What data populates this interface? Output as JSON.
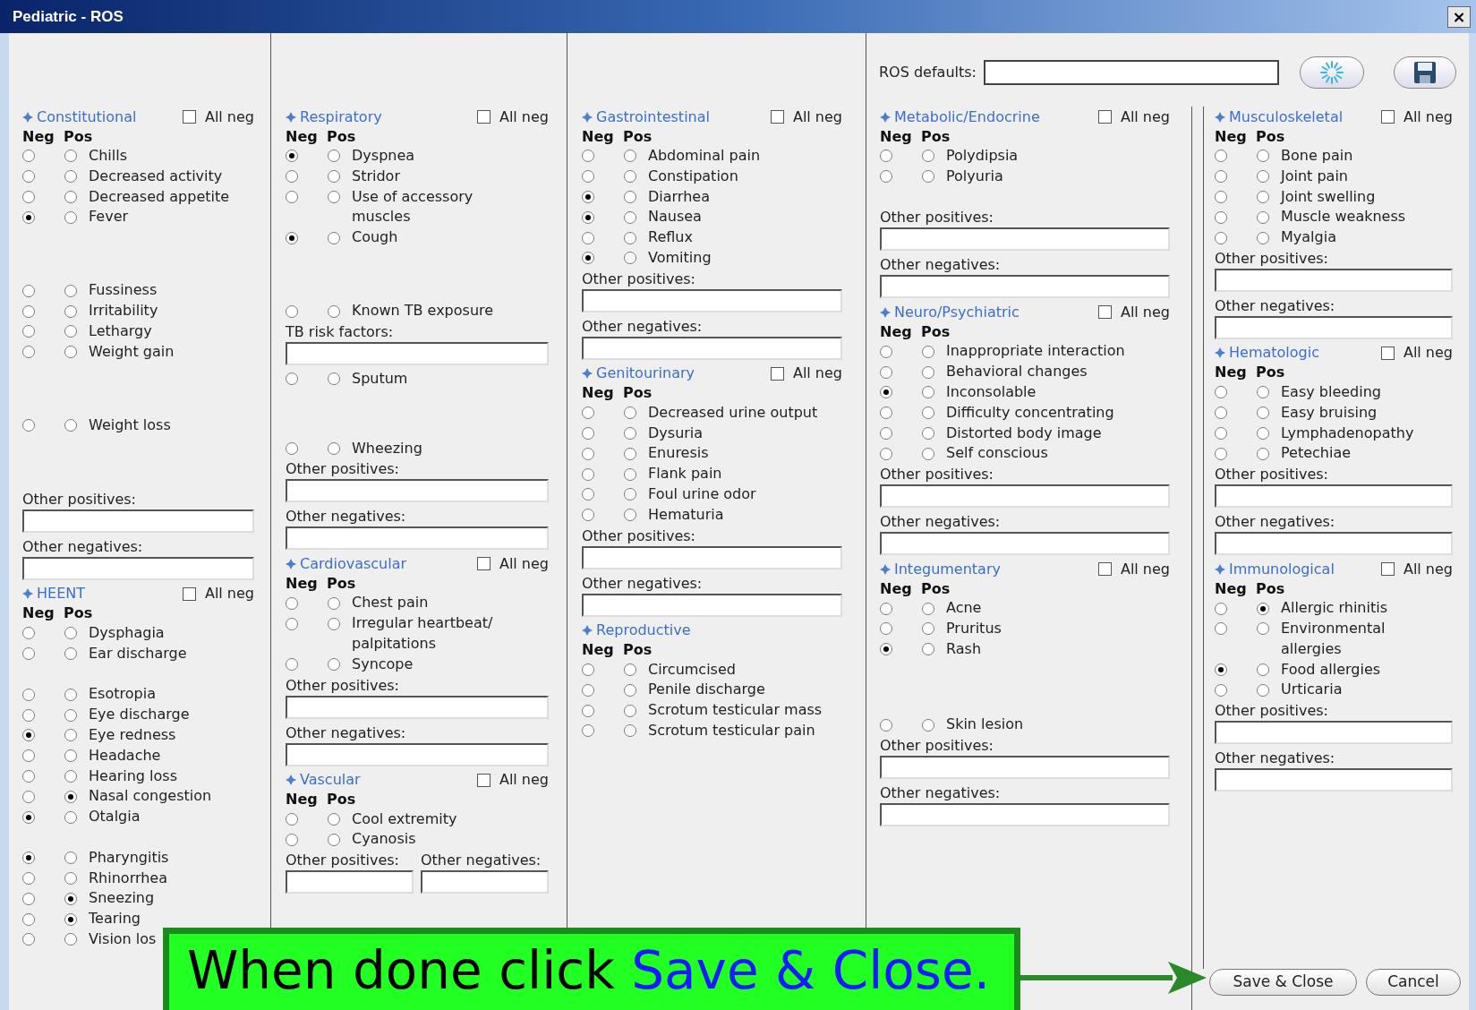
{
  "window": {
    "title": "Pediatric - ROS",
    "close": "×"
  },
  "ros_defaults": {
    "label": "ROS defaults:"
  },
  "columns": [
    {
      "sections": [
        {
          "title": "Constitutional",
          "all_neg": {
            "label": "All neg",
            "checked": false
          },
          "neg_label": "Neg",
          "pos_label": "Pos",
          "items": [
            {
              "kind": "radio",
              "label": "Chills",
              "neg_selected": false,
              "pos_selected": false
            },
            {
              "kind": "radio",
              "label": "Decreased activity",
              "neg_selected": false,
              "pos_selected": false
            },
            {
              "kind": "radio",
              "label": "Decreased appetite",
              "neg_selected": false,
              "pos_selected": false
            },
            {
              "kind": "radio",
              "label": "Fever",
              "neg_selected": true,
              "pos_selected": false
            },
            {
              "kind": "radio",
              "label": "Fussiness",
              "neg_selected": false,
              "pos_selected": false
            },
            {
              "kind": "radio",
              "label": "Irritability",
              "neg_selected": false,
              "pos_selected": false
            },
            {
              "kind": "radio",
              "label": "Lethargy",
              "neg_selected": false,
              "pos_selected": false
            },
            {
              "kind": "radio",
              "label": "Weight gain",
              "neg_selected": false,
              "pos_selected": false
            },
            {
              "kind": "radio",
              "label": "Weight loss",
              "neg_selected": false,
              "pos_selected": false
            }
          ],
          "fields": [
            {
              "label": "Other positives:"
            },
            {
              "label": "Other negatives:"
            }
          ]
        },
        {
          "title": "HEENT",
          "all_neg": {
            "label": "All neg",
            "checked": false
          },
          "neg_label": "Neg",
          "pos_label": "Pos",
          "items": [
            {
              "kind": "radio",
              "label": "Dysphagia",
              "neg_selected": false,
              "pos_selected": false
            },
            {
              "kind": "radio",
              "label": "Ear discharge",
              "neg_selected": false,
              "pos_selected": false
            },
            {
              "kind": "radio",
              "label": "Esotropia",
              "neg_selected": false,
              "pos_selected": false
            },
            {
              "kind": "radio",
              "label": "Eye discharge",
              "neg_selected": false,
              "pos_selected": false
            },
            {
              "kind": "radio",
              "label": "Eye redness",
              "neg_selected": true,
              "pos_selected": false
            },
            {
              "kind": "radio",
              "label": "Headache",
              "neg_selected": false,
              "pos_selected": false
            },
            {
              "kind": "radio",
              "label": "Hearing loss",
              "neg_selected": false,
              "pos_selected": false
            },
            {
              "kind": "radio",
              "label": "Nasal congestion",
              "neg_selected": false,
              "pos_selected": true
            },
            {
              "kind": "radio",
              "label": "Otalgia",
              "neg_selected": true,
              "pos_selected": false
            },
            {
              "kind": "radio",
              "label": "Pharyngitis",
              "neg_selected": true,
              "pos_selected": false
            },
            {
              "kind": "radio",
              "label": "Rhinorrhea",
              "neg_selected": false,
              "pos_selected": false
            },
            {
              "kind": "radio",
              "label": "Sneezing",
              "neg_selected": false,
              "pos_selected": true
            },
            {
              "kind": "radio",
              "label": "Tearing",
              "neg_selected": false,
              "pos_selected": true
            },
            {
              "kind": "radio",
              "label": "Vision los",
              "neg_selected": false,
              "pos_selected": false
            }
          ]
        }
      ]
    },
    {
      "sections": [
        {
          "title": "Respiratory",
          "all_neg": {
            "label": "All neg",
            "checked": false
          },
          "neg_label": "Neg",
          "pos_label": "Pos",
          "items": [
            {
              "kind": "radio",
              "label": "Dyspnea",
              "neg_selected": true,
              "pos_selected": false
            },
            {
              "kind": "radio",
              "label": "Stridor",
              "neg_selected": false,
              "pos_selected": false
            },
            {
              "kind": "radio",
              "label": "Use of accessory\nmuscles",
              "neg_selected": false,
              "pos_selected": false
            },
            {
              "kind": "radio",
              "label": "Cough",
              "neg_selected": true,
              "pos_selected": false
            },
            {
              "kind": "radio",
              "label": "Known TB exposure",
              "neg_selected": false,
              "pos_selected": false
            },
            {
              "kind": "field",
              "label": "TB risk factors:"
            },
            {
              "kind": "radio",
              "label": "Sputum",
              "neg_selected": false,
              "pos_selected": false
            },
            {
              "kind": "radio",
              "label": "Wheezing",
              "neg_selected": false,
              "pos_selected": false
            }
          ],
          "fields": [
            {
              "label": "Other positives:"
            },
            {
              "label": "Other negatives:"
            }
          ]
        },
        {
          "title": "Cardiovascular",
          "all_neg": {
            "label": "All neg",
            "checked": false
          },
          "neg_label": "Neg",
          "pos_label": "Pos",
          "items": [
            {
              "kind": "radio",
              "label": "Chest pain",
              "neg_selected": false,
              "pos_selected": false
            },
            {
              "kind": "radio",
              "label": "Irregular heartbeat/\npalpitations",
              "neg_selected": false,
              "pos_selected": false
            },
            {
              "kind": "radio",
              "label": "Syncope",
              "neg_selected": false,
              "pos_selected": false
            }
          ],
          "fields": [
            {
              "label": "Other positives:"
            },
            {
              "label": "Other negatives:"
            }
          ]
        },
        {
          "title": "Vascular",
          "all_neg": {
            "label": "All neg",
            "checked": false
          },
          "neg_label": "Neg",
          "pos_label": "Pos",
          "items": [
            {
              "kind": "radio",
              "label": "Cool extremity",
              "neg_selected": false,
              "pos_selected": false
            },
            {
              "kind": "radio",
              "label": "Cyanosis",
              "neg_selected": false,
              "pos_selected": false
            }
          ],
          "fields_inline": true,
          "fields": [
            {
              "label": "Other positives:"
            },
            {
              "label": "Other negatives:"
            }
          ]
        }
      ]
    },
    {
      "sections": [
        {
          "title": "Gastrointestinal",
          "all_neg": {
            "label": "All neg",
            "checked": false
          },
          "neg_label": "Neg",
          "pos_label": "Pos",
          "items": [
            {
              "kind": "radio",
              "label": "Abdominal pain",
              "neg_selected": false,
              "pos_selected": false
            },
            {
              "kind": "radio",
              "label": "Constipation",
              "neg_selected": false,
              "pos_selected": false
            },
            {
              "kind": "radio",
              "label": "Diarrhea",
              "neg_selected": true,
              "pos_selected": false
            },
            {
              "kind": "radio",
              "label": "Nausea",
              "neg_selected": true,
              "pos_selected": false
            },
            {
              "kind": "radio",
              "label": "Reflux",
              "neg_selected": false,
              "pos_selected": false
            },
            {
              "kind": "radio",
              "label": "Vomiting",
              "neg_selected": true,
              "pos_selected": false
            }
          ],
          "fields": [
            {
              "label": "Other positives:"
            },
            {
              "label": "Other negatives:"
            }
          ]
        },
        {
          "title": "Genitourinary",
          "all_neg": {
            "label": "All neg",
            "checked": false
          },
          "neg_label": "Neg",
          "pos_label": "Pos",
          "items": [
            {
              "kind": "radio",
              "label": "Decreased urine output",
              "neg_selected": false,
              "pos_selected": false
            },
            {
              "kind": "radio",
              "label": "Dysuria",
              "neg_selected": false,
              "pos_selected": false
            },
            {
              "kind": "radio",
              "label": "Enuresis",
              "neg_selected": false,
              "pos_selected": false
            },
            {
              "kind": "radio",
              "label": "Flank pain",
              "neg_selected": false,
              "pos_selected": false
            },
            {
              "kind": "radio",
              "label": "Foul urine odor",
              "neg_selected": false,
              "pos_selected": false
            },
            {
              "kind": "radio",
              "label": "Hematuria",
              "neg_selected": false,
              "pos_selected": false
            }
          ],
          "fields": [
            {
              "label": "Other positives:"
            },
            {
              "label": "Other negatives:"
            }
          ]
        },
        {
          "title": "Reproductive",
          "neg_label": "Neg",
          "pos_label": "Pos",
          "items": [
            {
              "kind": "radio",
              "label": "Circumcised",
              "neg_selected": false,
              "pos_selected": false
            },
            {
              "kind": "radio",
              "label": "Penile discharge",
              "neg_selected": false,
              "pos_selected": false
            },
            {
              "kind": "radio",
              "label": "Scrotum testicular mass",
              "neg_selected": false,
              "pos_selected": false
            },
            {
              "kind": "radio",
              "label": "Scrotum testicular pain",
              "neg_selected": false,
              "pos_selected": false
            }
          ]
        }
      ]
    },
    {
      "sections": [
        {
          "title": "Metabolic/Endocrine",
          "all_neg": {
            "label": "All neg",
            "checked": false
          },
          "neg_label": "Neg",
          "pos_label": "Pos",
          "items": [
            {
              "kind": "radio",
              "label": "Polydipsia",
              "neg_selected": false,
              "pos_selected": false
            },
            {
              "kind": "radio",
              "label": "Polyuria",
              "neg_selected": false,
              "pos_selected": false
            }
          ],
          "fields": [
            {
              "label": "Other positives:"
            },
            {
              "label": "Other negatives:"
            }
          ]
        },
        {
          "title": "Neuro/Psychiatric",
          "all_neg": {
            "label": "All neg",
            "checked": false
          },
          "neg_label": "Neg",
          "pos_label": "Pos",
          "items": [
            {
              "kind": "radio",
              "label": "Inappropriate interaction",
              "neg_selected": false,
              "pos_selected": false
            },
            {
              "kind": "radio",
              "label": "Behavioral changes",
              "neg_selected": false,
              "pos_selected": false
            },
            {
              "kind": "radio",
              "label": "Inconsolable",
              "neg_selected": true,
              "pos_selected": false
            },
            {
              "kind": "radio",
              "label": "Difficulty concentrating",
              "neg_selected": false,
              "pos_selected": false
            },
            {
              "kind": "radio",
              "label": "Distorted body image",
              "neg_selected": false,
              "pos_selected": false
            },
            {
              "kind": "radio",
              "label": "Self conscious",
              "neg_selected": false,
              "pos_selected": false
            }
          ],
          "fields": [
            {
              "label": "Other positives:"
            },
            {
              "label": "Other negatives:"
            }
          ]
        },
        {
          "title": "Integumentary",
          "all_neg": {
            "label": "All neg",
            "checked": false
          },
          "neg_label": "Neg",
          "pos_label": "Pos",
          "items": [
            {
              "kind": "radio",
              "label": "Acne",
              "neg_selected": false,
              "pos_selected": false
            },
            {
              "kind": "radio",
              "label": "Pruritus",
              "neg_selected": false,
              "pos_selected": false
            },
            {
              "kind": "radio",
              "label": "Rash",
              "neg_selected": true,
              "pos_selected": false
            },
            {
              "kind": "radio",
              "label": "Skin lesion",
              "neg_selected": false,
              "pos_selected": false
            }
          ],
          "fields": [
            {
              "label": "Other positives:"
            },
            {
              "label": "Other negatives:"
            }
          ]
        }
      ]
    },
    {
      "sections": [
        {
          "title": "Musculoskeletal",
          "all_neg": {
            "label": "All neg",
            "checked": false
          },
          "neg_label": "Neg",
          "pos_label": "Pos",
          "items": [
            {
              "kind": "radio",
              "label": "Bone pain",
              "neg_selected": false,
              "pos_selected": false
            },
            {
              "kind": "radio",
              "label": "Joint pain",
              "neg_selected": false,
              "pos_selected": false
            },
            {
              "kind": "radio",
              "label": "Joint swelling",
              "neg_selected": false,
              "pos_selected": false
            },
            {
              "kind": "radio",
              "label": "Muscle weakness",
              "neg_selected": false,
              "pos_selected": false
            },
            {
              "kind": "radio",
              "label": "Myalgia",
              "neg_selected": false,
              "pos_selected": false
            }
          ],
          "fields": [
            {
              "label": "Other positives:"
            },
            {
              "label": "Other negatives:"
            }
          ]
        },
        {
          "title": "Hematologic",
          "all_neg": {
            "label": "All neg",
            "checked": false
          },
          "neg_label": "Neg",
          "pos_label": "Pos",
          "items": [
            {
              "kind": "radio",
              "label": "Easy bleeding",
              "neg_selected": false,
              "pos_selected": false
            },
            {
              "kind": "radio",
              "label": "Easy bruising",
              "neg_selected": false,
              "pos_selected": false
            },
            {
              "kind": "radio",
              "label": "Lymphadenopathy",
              "neg_selected": false,
              "pos_selected": false
            },
            {
              "kind": "radio",
              "label": "Petechiae",
              "neg_selected": false,
              "pos_selected": false
            }
          ],
          "fields": [
            {
              "label": "Other positives:"
            },
            {
              "label": "Other negatives:"
            }
          ]
        },
        {
          "title": "Immunological",
          "all_neg": {
            "label": "All neg",
            "checked": false
          },
          "neg_label": "Neg",
          "pos_label": "Pos",
          "items": [
            {
              "kind": "radio",
              "label": "Allergic rhinitis",
              "neg_selected": false,
              "pos_selected": true
            },
            {
              "kind": "radio",
              "label": "Environmental\nallergies",
              "neg_selected": false,
              "pos_selected": false
            },
            {
              "kind": "radio",
              "label": "Food allergies",
              "neg_selected": true,
              "pos_selected": false
            },
            {
              "kind": "radio",
              "label": "Urticaria",
              "neg_selected": false,
              "pos_selected": false
            }
          ],
          "fields": [
            {
              "label": "Other positives:"
            },
            {
              "label": "Other negatives:"
            }
          ]
        }
      ]
    }
  ],
  "buttons": [
    {
      "label": "Save & Close"
    },
    {
      "label": "Cancel"
    }
  ],
  "callout": {
    "text": "When done click",
    "highlight": "Save & Close."
  }
}
